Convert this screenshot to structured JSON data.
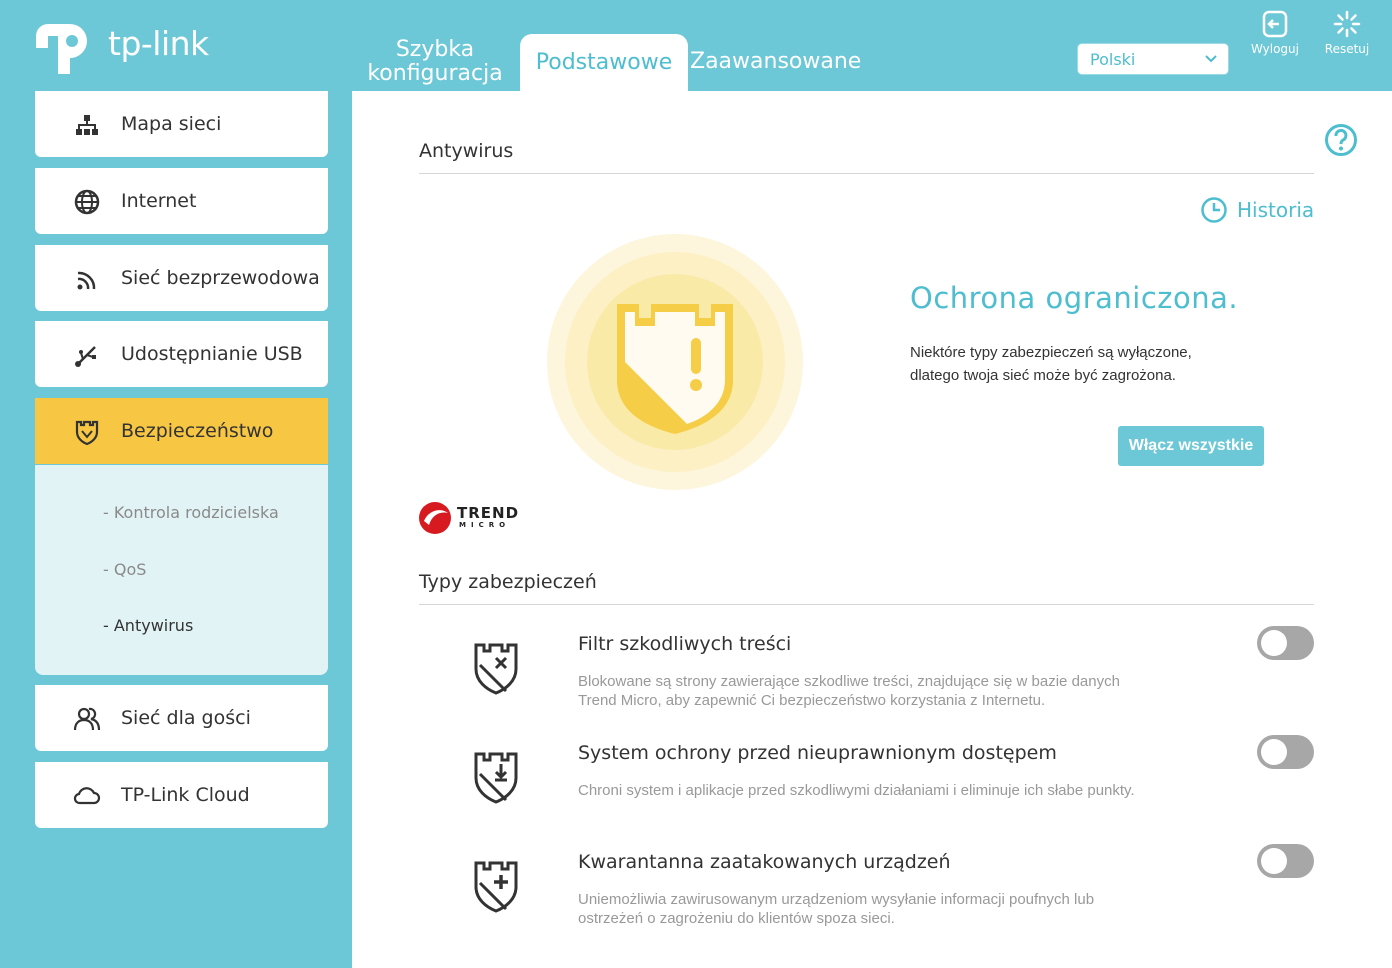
{
  "brand": {
    "name": "tp-link"
  },
  "header": {
    "tabs": [
      {
        "label": "Szybka\nkonfiguracja",
        "active": false
      },
      {
        "label": "Podstawowe",
        "active": true
      },
      {
        "label": "Zaawansowane",
        "active": false
      }
    ],
    "language": {
      "selected": "Polski"
    },
    "logout_label": "Wyloguj",
    "reset_label": "Resetuj"
  },
  "sidebar": {
    "items": [
      {
        "label": "Mapa sieci",
        "icon": "network-map-icon"
      },
      {
        "label": "Internet",
        "icon": "globe-icon"
      },
      {
        "label": "Sieć bezprzewodowa",
        "icon": "wireless-icon"
      },
      {
        "label": "Udostępnianie USB",
        "icon": "usb-icon"
      },
      {
        "label": "Bezpieczeństwo",
        "icon": "security-shield-icon",
        "active": true
      },
      {
        "label": "Sieć dla gości",
        "icon": "guests-icon"
      },
      {
        "label": "TP-Link Cloud",
        "icon": "cloud-icon"
      }
    ],
    "security_sub": [
      {
        "label": "Kontrola rodzicielska",
        "selected": false
      },
      {
        "label": "QoS",
        "selected": false
      },
      {
        "label": "Antywirus",
        "selected": true
      }
    ]
  },
  "main": {
    "title": "Antywirus",
    "history_label": "Historia",
    "status_title": "Ochrona ograniczona.",
    "status_desc_1": "Niektóre typy zabezpieczeń są wyłączone,",
    "status_desc_2": "dlatego twoja sieć może być zagrożona.",
    "enable_all_label": "Włącz wszystkie",
    "partner_logo": {
      "name": "TREND",
      "sub": "MICRO"
    },
    "types_title": "Typy zabezpieczeń",
    "features": [
      {
        "title": "Filtr szkodliwych treści",
        "desc_1": "Blokowane są strony zawierające szkodliwe treści, znajdujące się w bazie danych",
        "desc_2": "Trend Micro, aby zapewnić Ci bezpieczeństwo korzystania z Internetu.",
        "enabled": false
      },
      {
        "title": "System ochrony przed nieuprawnionym dostępem",
        "desc_1": "Chroni system i aplikacje przed szkodliwymi działaniami i eliminuje ich słabe punkty.",
        "desc_2": "",
        "enabled": false
      },
      {
        "title": "Kwarantanna zaatakowanych urządzeń",
        "desc_1": "Uniemożliwia zawirusowanym urządzeniom wysyłanie informacji poufnych lub",
        "desc_2": "ostrzeżeń o zagrożeniu do klientów spoza sieci.",
        "enabled": false
      }
    ]
  },
  "colors": {
    "accent": "#4dbdd0",
    "background": "#6cc8d6",
    "active_nav": "#f7c744",
    "shield": "#f6cd47"
  }
}
